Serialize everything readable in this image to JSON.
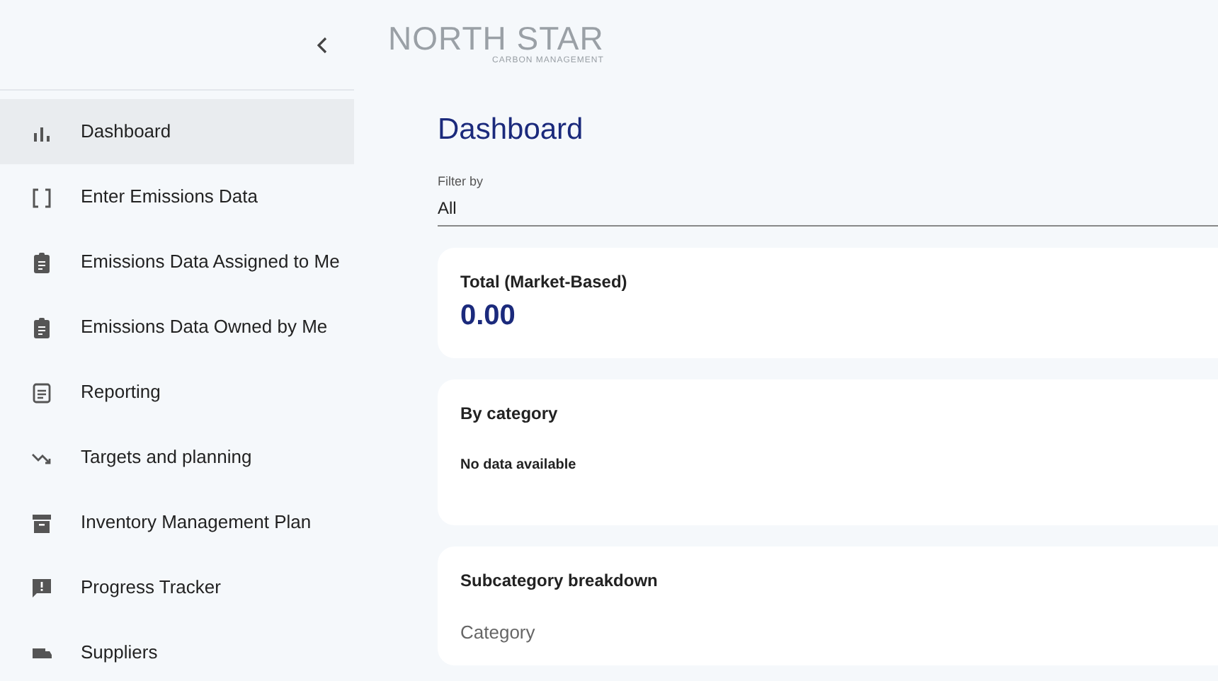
{
  "logo": {
    "name": "NORTH STAR",
    "tagline": "CARBON MANAGEMENT"
  },
  "sidebar": {
    "items": [
      {
        "label": "Dashboard",
        "selected": true
      },
      {
        "label": "Enter Emissions Data",
        "selected": false
      },
      {
        "label": "Emissions Data Assigned to Me",
        "selected": false
      },
      {
        "label": "Emissions Data Owned by Me",
        "selected": false
      },
      {
        "label": "Reporting",
        "selected": false
      },
      {
        "label": "Targets and planning",
        "selected": false
      },
      {
        "label": "Inventory Management Plan",
        "selected": false
      },
      {
        "label": "Progress Tracker",
        "selected": false
      },
      {
        "label": "Suppliers",
        "selected": false
      }
    ]
  },
  "page_title": "Dashboard",
  "filter": {
    "label": "Filter by",
    "value": "All"
  },
  "cards": [
    {
      "title": "Total (Market-Based)",
      "value": "0.00"
    },
    {
      "title": "By category",
      "message": "No data available"
    },
    {
      "title": "Subcategory breakdown",
      "field_label": "Category"
    }
  ]
}
